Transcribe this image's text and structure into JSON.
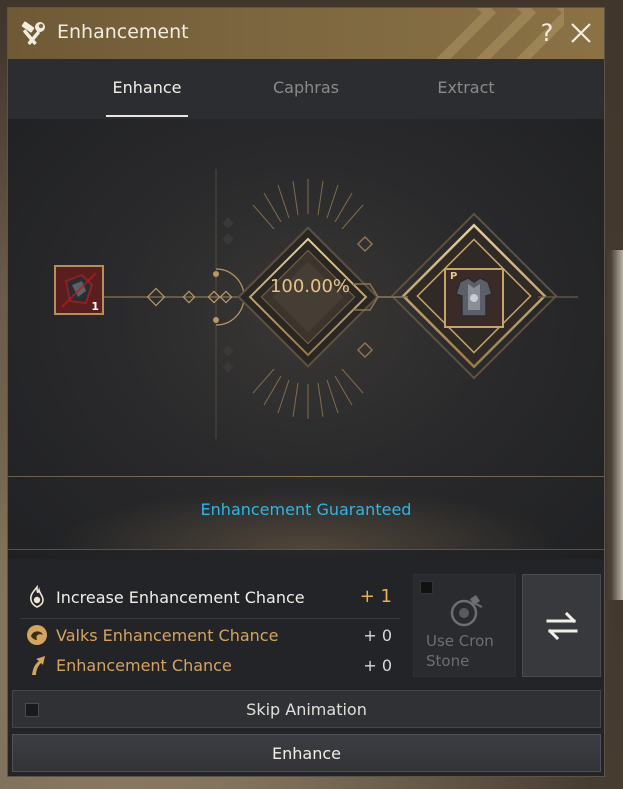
{
  "window": {
    "title": "Enhancement",
    "help_label": "?",
    "title_icon": "hammer-wrench-icon",
    "close_icon": "close-icon"
  },
  "tabs": [
    {
      "label": "Enhance",
      "active": true
    },
    {
      "label": "Caphras",
      "active": false
    },
    {
      "label": "Extract",
      "active": false
    }
  ],
  "stage": {
    "success_chance": "100.00%",
    "material": {
      "count": "1",
      "icon": "black-stone-icon"
    },
    "result": {
      "grade_mark": "P",
      "icon": "armor-chest-icon"
    },
    "status_text": "Enhancement Guaranteed"
  },
  "bonuses": [
    {
      "label": "Increase Enhancement Chance",
      "value": "+ 1",
      "icon": "flame-orb-icon"
    },
    {
      "label": "Valks Enhancement Chance",
      "value": "+ 0",
      "icon": "valks-orb-icon"
    },
    {
      "label": "Enhancement Chance",
      "value": "+ 0",
      "icon": "up-arrow-icon"
    }
  ],
  "cron_stone": {
    "label": "Use Cron Stone",
    "checked": false,
    "icon": "cron-stone-icon"
  },
  "swap": {
    "icon": "swap-arrows-icon"
  },
  "skip_animation": {
    "label": "Skip Animation",
    "checked": false
  },
  "enhance_button": {
    "label": "Enhance"
  },
  "colors": {
    "accent_gold": "#d5a461",
    "value_gold": "#e9b24b",
    "status_blue": "#2fb6e4",
    "title_bar": "#7d6740"
  }
}
